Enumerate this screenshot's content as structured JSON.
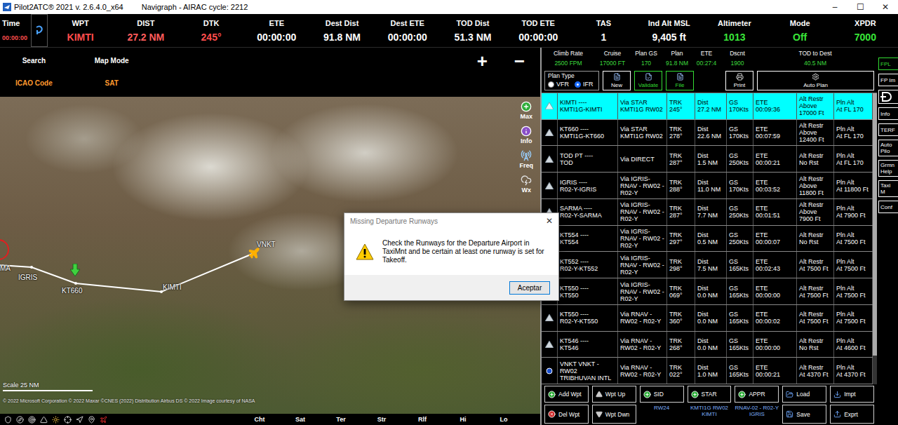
{
  "window": {
    "title": "Pilot2ATC® 2021 v. 2.6.4.0_x64",
    "subtitle": "Navigraph - AIRAC cycle: 2212",
    "controls": [
      "–",
      "☐",
      "✕"
    ]
  },
  "status_bar": [
    {
      "label": "Time",
      "value": "00:00:00",
      "color": "#ff4d4d",
      "kind": "compact"
    },
    {
      "label": "WPT",
      "value": "KIMTI",
      "color": "#ff4d4d",
      "kind": "field"
    },
    {
      "label": "DIST",
      "value": "27.2 NM",
      "color": "#ff5c5c",
      "kind": "field"
    },
    {
      "label": "DTK",
      "value": "245°",
      "color": "#ff4d4d",
      "kind": "field"
    },
    {
      "label": "ETE",
      "value": "00:00:00",
      "color": "#ffffff",
      "kind": "field"
    },
    {
      "label": "Dest Dist",
      "value": "91.8 NM",
      "color": "#ffffff",
      "kind": "field"
    },
    {
      "label": "Dest ETE",
      "value": "00:00:00",
      "color": "#ffffff",
      "kind": "field"
    },
    {
      "label": "TOD Dist",
      "value": "51.3 NM",
      "color": "#ffffff",
      "kind": "field"
    },
    {
      "label": "TOD ETE",
      "value": "00:00:00",
      "color": "#ffffff",
      "kind": "field"
    },
    {
      "label": "TAS",
      "value": "1",
      "color": "#ffffff",
      "kind": "field"
    },
    {
      "label": "Ind Alt MSL",
      "value": "9,405 ft",
      "color": "#ffffff",
      "kind": "field"
    },
    {
      "label": "Altimeter",
      "value": "1013",
      "color": "#39e639",
      "kind": "field"
    },
    {
      "label": "Mode",
      "value": "Off",
      "color": "#39e639",
      "kind": "field"
    },
    {
      "label": "XPDR",
      "value": "7000",
      "color": "#39e639",
      "kind": "field"
    }
  ],
  "map": {
    "search_label": "Search",
    "search_value": "ICAO Code",
    "mode_label": "Map Mode",
    "mode_value": "SAT",
    "zoom": [
      "+",
      "−"
    ],
    "tools": [
      "Max",
      "Info",
      "Freq",
      "Wx"
    ],
    "labels": [
      "MA",
      "IGRIS",
      "KT660",
      "KIMTI",
      "VNKT"
    ],
    "scale": "Scale 25 NM",
    "attribution": "© 2022 Microsoft Corporation © 2022 Maxar ©CNES (2022) Distribution Airbus DS © 2022 Image courtesy of NASA",
    "layers": [
      "Cht",
      "Sat",
      "Ter",
      "Str",
      "Rlf",
      "Hi",
      "Lo"
    ]
  },
  "dialog": {
    "title": "Missing Departure Runways",
    "close": "✕",
    "message": "Check the Runways for the Departure Airport in TaxiMnt and be certain at least one runway is set for Takeoff.",
    "button": "Aceptar"
  },
  "flight_plan": {
    "summary": [
      {
        "label": "Climb Rate",
        "value": "2500 FPM"
      },
      {
        "label": "Cruise",
        "value": "17000 FT"
      },
      {
        "label": "Plan GS",
        "value": "170"
      },
      {
        "label": "Plan",
        "value": "91.8 NM"
      },
      {
        "label": "ETE",
        "value": "00:27:4"
      },
      {
        "label": "Dscnt",
        "value": "1900"
      },
      {
        "label": "TOD to Dest",
        "value": "40.5 NM"
      }
    ],
    "plan_type": {
      "legend": "Plan Type",
      "options": [
        {
          "label": "VFR",
          "selected": false
        },
        {
          "label": "IFR",
          "selected": true
        }
      ]
    },
    "buttons": [
      {
        "label": "New",
        "color": "#ffffff"
      },
      {
        "label": "Validate",
        "color": "#33dd33"
      },
      {
        "label": "File",
        "color": "#33dd33"
      },
      {
        "label": "Print",
        "color": "#ffffff"
      },
      {
        "label": "Auto Plan",
        "color": "#ffffff"
      }
    ],
    "labels": {
      "trk": "TRK",
      "dist": "Dist",
      "gs": "GS",
      "ete": "ETE",
      "alt": "Alt Restr",
      "pln": "Pln Alt"
    },
    "rows": [
      {
        "name": [
          "KIMTI  ----",
          "KMTI1G-KIMTI"
        ],
        "via": [
          "Via STAR",
          "KMTI1G RW02"
        ],
        "trk": "245°",
        "dist": "27.2 NM",
        "gs": "170Kts",
        "ete": "00:09:36",
        "alt": "Above 17000 Ft",
        "pln": "At FL 170",
        "selected": true,
        "kind": "waypoint"
      },
      {
        "name": [
          "KT660  ----",
          "KMTI1G-KT660"
        ],
        "via": [
          "Via STAR",
          "KMTI1G RW02"
        ],
        "trk": "278°",
        "dist": "22.6 NM",
        "gs": "170Kts",
        "ete": "00:07:59",
        "alt": "Above 12400 Ft",
        "pln": "At FL 170",
        "selected": false,
        "kind": "waypoint"
      },
      {
        "name": [
          "TOD PT  ----",
          "TOD"
        ],
        "via": [
          "Via DIRECT"
        ],
        "trk": "287°",
        "dist": "1.5 NM",
        "gs": "250Kts",
        "ete": "00:00:21",
        "alt": "No Rst",
        "pln": "At FL 170",
        "selected": false,
        "kind": "waypoint"
      },
      {
        "name": [
          "IGRIS  ----",
          "R02-Y-IGRIS"
        ],
        "via": [
          "Via IGRIS-RNAV - RW02 - R02-Y"
        ],
        "trk": "288°",
        "dist": "11.0 NM",
        "gs": "170Kts",
        "ete": "00:03:52",
        "alt": "Above 11800 Ft",
        "pln": "At 11800 Ft",
        "selected": false,
        "kind": "waypoint"
      },
      {
        "name": [
          "SARMA  ----",
          "R02-Y-SARMA"
        ],
        "via": [
          "Via IGRIS-RNAV - RW02 - R02-Y"
        ],
        "trk": "287°",
        "dist": "7.7 NM",
        "gs": "250Kts",
        "ete": "00:01:51",
        "alt": "Above 7900 Ft",
        "pln": "At 7900 Ft",
        "selected": false,
        "kind": "waypoint"
      },
      {
        "name": [
          "KT554  ----",
          "KT554"
        ],
        "via": [
          "Via IGRIS-RNAV - RW02 - R02-Y"
        ],
        "trk": "297°",
        "dist": "0.5 NM",
        "gs": "250Kts",
        "ete": "00:00:07",
        "alt": "No Rst",
        "pln": "At 7500 Ft",
        "selected": false,
        "kind": "waypoint"
      },
      {
        "name": [
          "KT552  ----",
          "R02-Y-KT552"
        ],
        "via": [
          "Via IGRIS-RNAV - RW02 - R02-Y"
        ],
        "trk": "298°",
        "dist": "7.5 NM",
        "gs": "165Kts",
        "ete": "00:02:43",
        "alt": "At 7500 Ft",
        "pln": "At 7500 Ft",
        "selected": false,
        "kind": "waypoint"
      },
      {
        "name": [
          "KT550  ----",
          "KT550"
        ],
        "via": [
          "Via IGRIS-RNAV - RW02 - R02-Y"
        ],
        "trk": "069°",
        "dist": "0.0 NM",
        "gs": "165Kts",
        "ete": "00:00:00",
        "alt": "At 7500 Ft",
        "pln": "At 7500 Ft",
        "selected": false,
        "kind": "waypoint"
      },
      {
        "name": [
          "KT550  ----",
          "R02-Y-KT550"
        ],
        "via": [
          "Via RNAV - RW02 - R02-Y"
        ],
        "trk": "360°",
        "dist": "0.0 NM",
        "gs": "165Kts",
        "ete": "00:00:02",
        "alt": "At 7500 Ft",
        "pln": "At 7500 Ft",
        "selected": false,
        "kind": "waypoint"
      },
      {
        "name": [
          "KT546  ----",
          "KT546"
        ],
        "via": [
          "Via RNAV - RW02 - R02-Y"
        ],
        "trk": "268°",
        "dist": "0.0 NM",
        "gs": "165Kts",
        "ete": "00:00:00",
        "alt": "No Rst",
        "pln": "At 4600 Ft",
        "selected": false,
        "kind": "waypoint"
      },
      {
        "name": [
          "VNKT  VNKT -",
          "RW02",
          "TRIBHUVAN INTL"
        ],
        "via": [
          "Via RNAV - RW02 - R02-Y"
        ],
        "trk": "022°",
        "dist": "1.0 NM",
        "gs": "165Kts",
        "ete": "00:00:21",
        "alt": "At 4370 Ft",
        "pln": "At 4370 Ft",
        "selected": false,
        "kind": "airport"
      }
    ],
    "bottom_rows": [
      [
        {
          "label": "Add Wpt",
          "kind": "button"
        },
        {
          "label": "Wpt Up",
          "kind": "button"
        },
        {
          "label": "SID",
          "kind": "button"
        },
        {
          "label": "STAR",
          "kind": "button"
        },
        {
          "label": "APPR",
          "kind": "button"
        },
        {
          "label": "Load",
          "kind": "button"
        },
        {
          "label": "Impt",
          "kind": "button"
        }
      ],
      [
        {
          "label": "Del Wpt",
          "kind": "button"
        },
        {
          "label": "Wpt Dwn",
          "kind": "button"
        },
        {
          "label": "RW24",
          "kind": "label"
        },
        {
          "label": "KMTI1G RW02 KIMTI",
          "kind": "label"
        },
        {
          "label": "RNAV-02 - R02-Y IGRIS",
          "kind": "label"
        },
        {
          "label": "Save",
          "kind": "button"
        },
        {
          "label": "Exprt",
          "kind": "button"
        }
      ]
    ],
    "side_buttons": [
      {
        "label": "FPL",
        "kind": "button",
        "color": "#33dd33"
      },
      {
        "label": "FP Im",
        "kind": "button",
        "color": "#ffffff"
      },
      {
        "label": "",
        "kind": "icon",
        "color": "#ffffff"
      },
      {
        "label": "Info",
        "kind": "button",
        "color": "#ffffff"
      },
      {
        "label": "TERF",
        "kind": "button",
        "color": "#ffffff"
      },
      {
        "label": "Auto Pilo",
        "kind": "button",
        "color": "#ffffff"
      },
      {
        "label": "Grmn Help",
        "kind": "button",
        "color": "#ffffff"
      },
      {
        "label": "Taxi M",
        "kind": "button",
        "color": "#ffffff"
      },
      {
        "label": "Conf",
        "kind": "button",
        "color": "#ffffff"
      }
    ]
  }
}
